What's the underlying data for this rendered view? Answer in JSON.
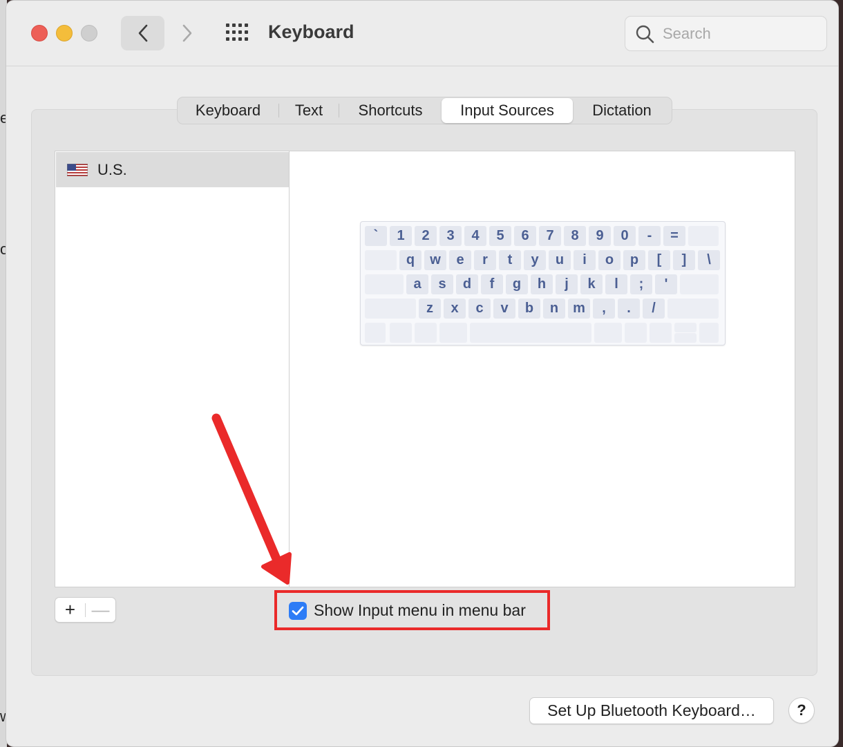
{
  "backdrop": {
    "left_bleed_chars": [
      "e",
      "o",
      "w"
    ]
  },
  "window": {
    "title": "Keyboard",
    "search": {
      "placeholder": "Search",
      "value": ""
    }
  },
  "tabs": [
    {
      "label": "Keyboard",
      "active": false
    },
    {
      "label": "Text",
      "active": false
    },
    {
      "label": "Shortcuts",
      "active": false
    },
    {
      "label": "Input Sources",
      "active": true
    },
    {
      "label": "Dictation",
      "active": false
    }
  ],
  "input_sources": {
    "items": [
      {
        "label": "U.S.",
        "icon": "us-flag-icon",
        "selected": true
      }
    ]
  },
  "keyboard_layout": {
    "row1": [
      "`",
      "1",
      "2",
      "3",
      "4",
      "5",
      "6",
      "7",
      "8",
      "9",
      "0",
      "-",
      "="
    ],
    "row2": [
      "q",
      "w",
      "e",
      "r",
      "t",
      "y",
      "u",
      "i",
      "o",
      "p",
      "[",
      "]",
      "\\"
    ],
    "row3": [
      "a",
      "s",
      "d",
      "f",
      "g",
      "h",
      "j",
      "k",
      "l",
      ";",
      "'"
    ],
    "row4": [
      "z",
      "x",
      "c",
      "v",
      "b",
      "n",
      "m",
      ",",
      ".",
      "/"
    ]
  },
  "list_controls": {
    "add_label": "+",
    "remove_label": "—"
  },
  "show_input_menu": {
    "label": "Show Input menu in menu bar",
    "checked": true
  },
  "footer": {
    "bluetooth_button": "Set Up Bluetooth Keyboard…",
    "help_button": "?"
  },
  "colors": {
    "accent": "#2d7cf6",
    "annotation": "#ea2a2a",
    "key_text": "#4b5f93"
  }
}
